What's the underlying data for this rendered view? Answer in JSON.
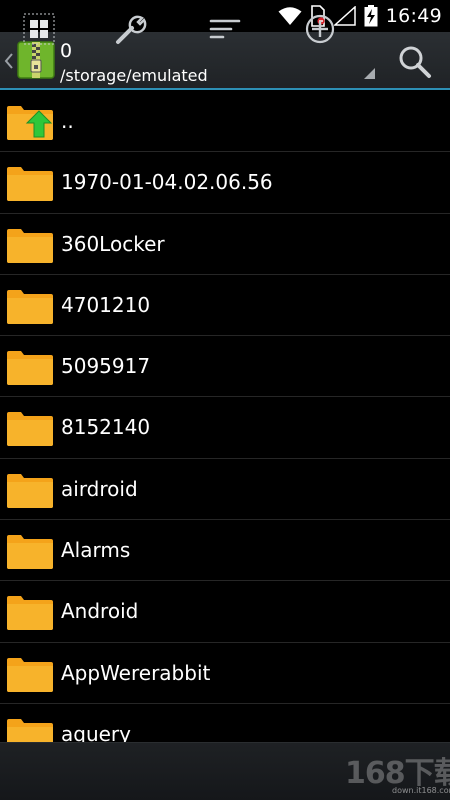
{
  "status_bar": {
    "time": "16:49",
    "icons": [
      "wifi-icon",
      "sim-card-icon",
      "signal-icon",
      "battery-charging-icon"
    ]
  },
  "header": {
    "folder_name": "0",
    "path": "/storage/emulated",
    "app_icon": "zip-archive-icon",
    "back_icon": "chevron-left-icon",
    "search_icon": "search-icon"
  },
  "files": [
    {
      "name": "..",
      "type": "parent"
    },
    {
      "name": "1970-01-04.02.06.56",
      "type": "folder"
    },
    {
      "name": "360Locker",
      "type": "folder"
    },
    {
      "name": "4701210",
      "type": "folder"
    },
    {
      "name": "5095917",
      "type": "folder"
    },
    {
      "name": "8152140",
      "type": "folder"
    },
    {
      "name": "airdroid",
      "type": "folder"
    },
    {
      "name": "Alarms",
      "type": "folder"
    },
    {
      "name": "Android",
      "type": "folder"
    },
    {
      "name": "AppWererabbit",
      "type": "folder"
    },
    {
      "name": "aquery",
      "type": "folder"
    }
  ],
  "bottom_bar": {
    "buttons": [
      "grid-view-icon",
      "wrench-icon",
      "sort-icon",
      "add-icon"
    ]
  },
  "watermark": {
    "text": "168下载",
    "domain": "down.it168.com"
  },
  "colors": {
    "accent": "#33b5e5",
    "folder": "#f4a31a",
    "up_arrow": "#2fc73a"
  }
}
